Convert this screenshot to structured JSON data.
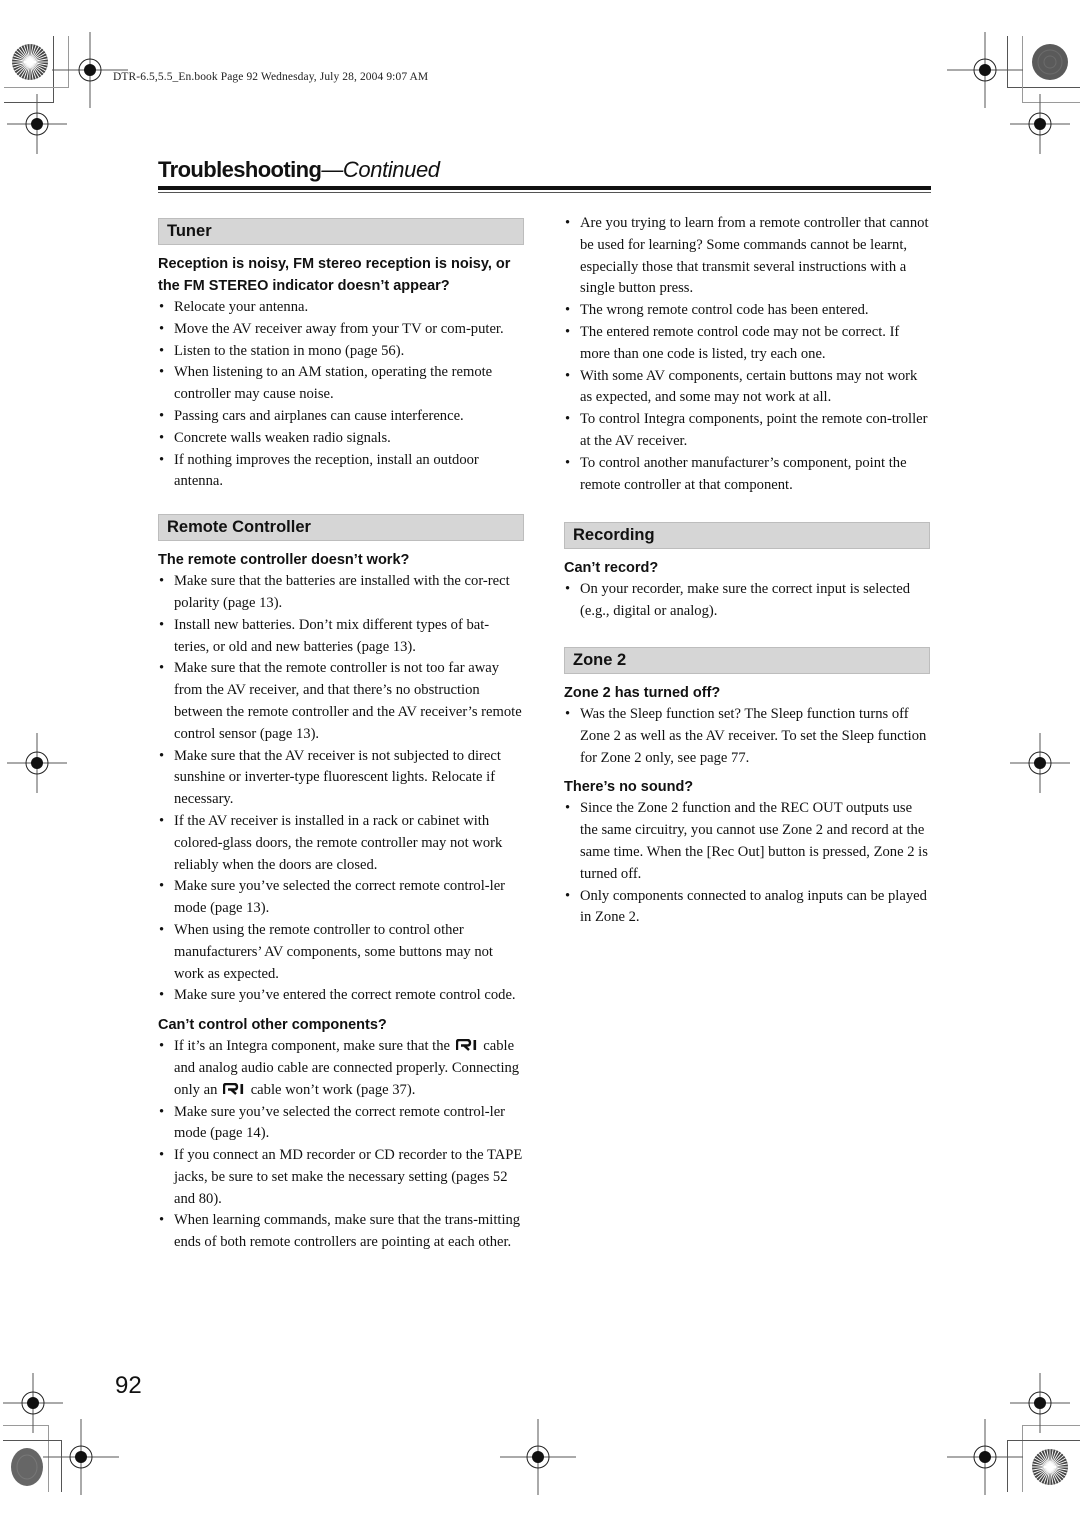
{
  "header": {
    "book_line": "DTR-6.5,5.5_En.book  Page 92  Wednesday, July 28, 2004  9:07 AM",
    "title_main": "Troubleshooting",
    "title_cont": "—Continued"
  },
  "sections_left": [
    {
      "heading": "Tuner",
      "groups": [
        {
          "question": "Reception is noisy, FM stereo reception is noisy, or the FM STEREO indicator doesn’t appear?",
          "items": [
            "Relocate your antenna.",
            "Move the AV receiver away from your TV or com-puter.",
            "Listen to the station in mono (page 56).",
            "When listening to an AM station, operating the remote controller may cause noise.",
            "Passing cars and airplanes can cause interference.",
            "Concrete walls weaken radio signals.",
            "If nothing improves the reception, install an outdoor antenna."
          ]
        }
      ]
    },
    {
      "heading": "Remote Controller",
      "groups": [
        {
          "question": "The remote controller doesn’t work?",
          "items": [
            "Make sure that the batteries are installed with the cor-rect polarity (page 13).",
            "Install new batteries. Don’t mix different types of bat-teries, or old and new batteries (page 13).",
            "Make sure that the remote controller is not too far away from the AV receiver, and that there’s no obstruction between the remote controller and the AV receiver’s remote control sensor (page 13).",
            "Make sure that the AV receiver is not subjected to direct sunshine or inverter-type fluorescent lights. Relocate if necessary.",
            "If the AV receiver is installed in a rack or cabinet with colored-glass doors, the remote controller may not work reliably when the doors are closed.",
            "Make sure you’ve selected the correct remote control-ler mode (page 13).",
            "When using the remote controller to control other manufacturers’ AV components, some buttons may not work as expected.",
            "Make sure you’ve entered the correct remote control code."
          ]
        },
        {
          "question": "Can’t control other components?",
          "ri_item": {
            "part1": "If it’s an Integra component, make sure that the",
            "part2": "cable and analog audio cable are connected properly. Connecting only an",
            "part3": "cable won’t work (page 37).",
            "icon": "ri-logo-icon"
          },
          "items": [
            "Make sure you’ve selected the correct remote control-ler mode (page 14).",
            "If you connect an MD recorder or CD recorder to the TAPE jacks, be sure to set make the necessary setting (pages 52 and 80).",
            "When learning commands, make sure that the trans-mitting ends of both remote controllers are pointing at each other."
          ]
        }
      ]
    }
  ],
  "right_continued_items": [
    "Are you trying to learn from a remote controller that cannot be used for learning? Some commands cannot be learnt, especially those that transmit several instructions with a single button press.",
    "The wrong remote control code has been entered.",
    "The entered remote control code may not be correct. If more than one code is listed, try each one.",
    "With some AV components, certain buttons may not work as expected, and some may not work at all.",
    "To control Integra components, point the remote con-troller at the AV receiver.",
    "To control another manufacturer’s component, point the remote controller at that component."
  ],
  "sections_right": [
    {
      "heading": "Recording",
      "groups": [
        {
          "question": "Can’t record?",
          "items": [
            "On your recorder, make sure the correct input is selected (e.g., digital or analog)."
          ]
        }
      ]
    },
    {
      "heading": "Zone 2",
      "groups": [
        {
          "question": "Zone 2 has turned off?",
          "items": [
            "Was the Sleep function set? The Sleep function turns off Zone 2 as well as the AV receiver. To set the Sleep function for Zone 2 only, see page 77."
          ]
        },
        {
          "question": "There’s no sound?",
          "items": [
            "Since the Zone 2 function and the REC OUT outputs use the same circuitry, you cannot use Zone 2 and record at the same time. When the [Rec Out] button is pressed, Zone 2 is turned off.",
            "Only components connected to analog inputs can be played in Zone 2."
          ]
        }
      ]
    }
  ],
  "footer": {
    "page_number": "92"
  }
}
